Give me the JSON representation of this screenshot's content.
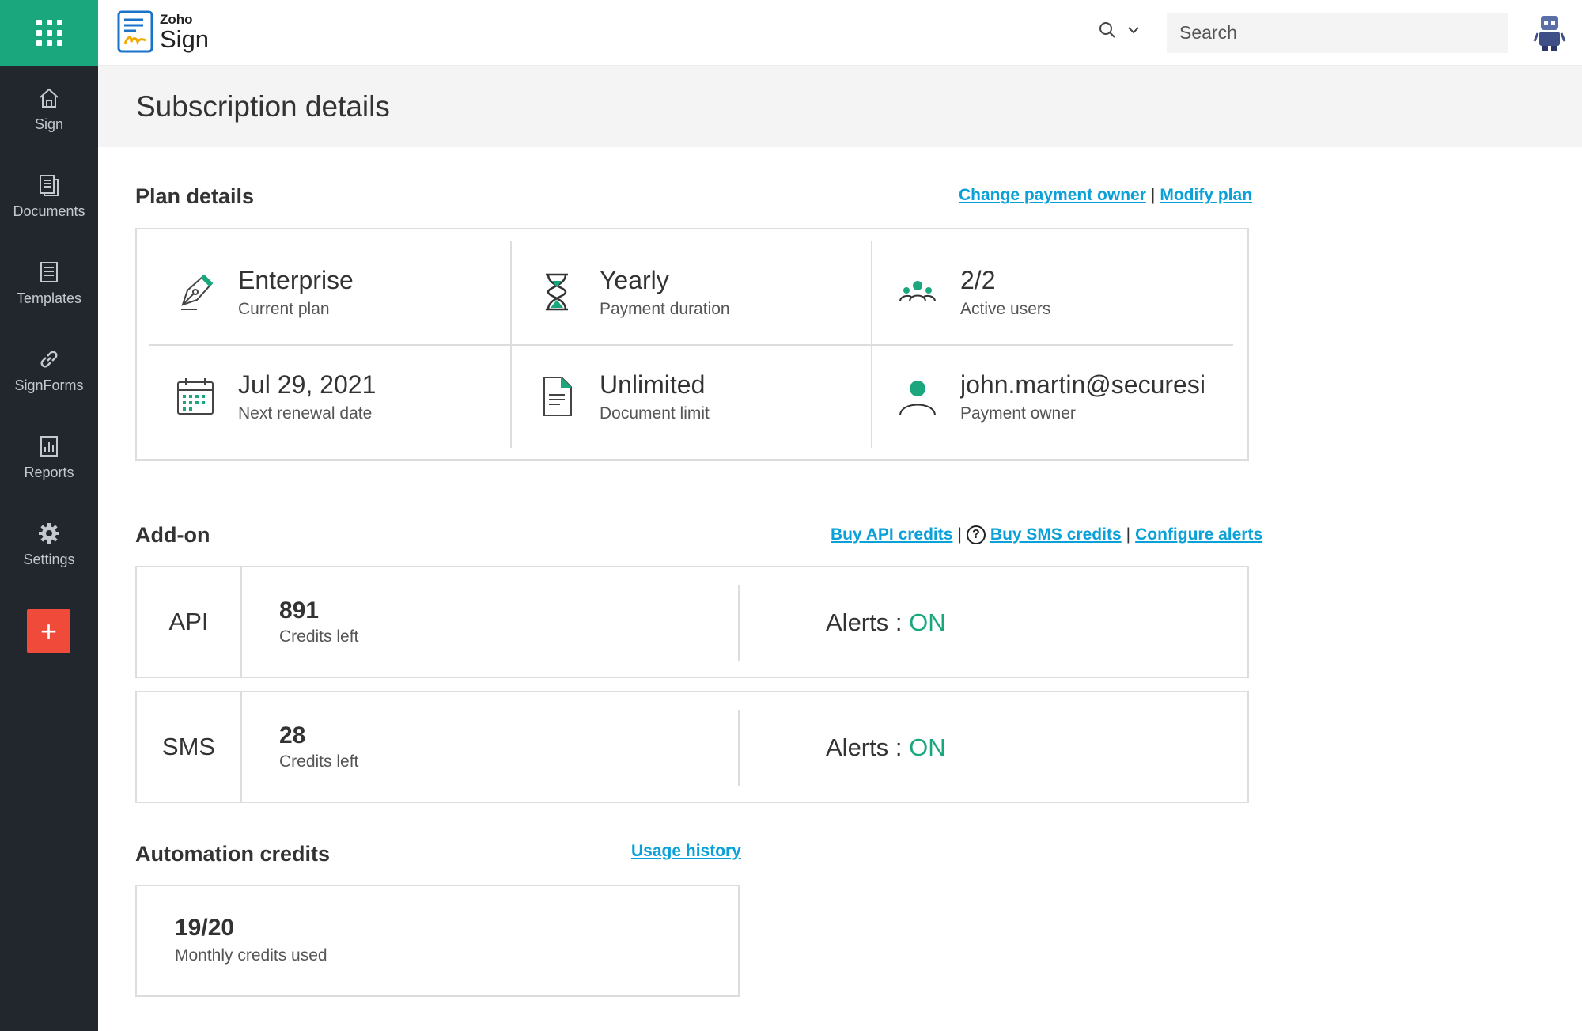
{
  "app": {
    "brand_small": "Zoho",
    "brand_name": "Sign"
  },
  "sidebar": {
    "items": [
      {
        "label": "Sign",
        "icon": "home-icon"
      },
      {
        "label": "Documents",
        "icon": "documents-icon"
      },
      {
        "label": "Templates",
        "icon": "templates-icon"
      },
      {
        "label": "SignForms",
        "icon": "link-icon"
      },
      {
        "label": "Reports",
        "icon": "reports-icon"
      },
      {
        "label": "Settings",
        "icon": "gear-icon"
      }
    ],
    "add_label": "+"
  },
  "header": {
    "search_placeholder": "Search"
  },
  "page": {
    "title": "Subscription details"
  },
  "plan": {
    "title": "Plan details",
    "links": {
      "change_owner": "Change payment owner",
      "separator": "|",
      "modify": "Modify plan"
    },
    "cells": [
      {
        "value": "Enterprise",
        "label": "Current plan",
        "icon": "pen-nib-icon"
      },
      {
        "value": "Yearly",
        "label": "Payment duration",
        "icon": "hourglass-icon"
      },
      {
        "value": "2/2",
        "label": "Active users",
        "icon": "users-icon"
      },
      {
        "value": "Jul 29, 2021",
        "label": "Next renewal date",
        "icon": "calendar-icon"
      },
      {
        "value": "Unlimited",
        "label": "Document limit",
        "icon": "document-icon"
      },
      {
        "value": "john.martin@securesig",
        "label": "Payment owner",
        "icon": "user-icon"
      }
    ]
  },
  "addon": {
    "title": "Add-on",
    "links": {
      "buy_api": "Buy API credits",
      "sep1": "|",
      "help": "?",
      "buy_sms": "Buy SMS credits",
      "sep2": "|",
      "configure": "Configure alerts"
    },
    "items": [
      {
        "name": "API",
        "credits": "891",
        "credits_label": "Credits left",
        "alerts_label": "Alerts :",
        "alerts_value": "ON"
      },
      {
        "name": "SMS",
        "credits": "28",
        "credits_label": "Credits left",
        "alerts_label": "Alerts :",
        "alerts_value": "ON"
      }
    ]
  },
  "automation": {
    "title": "Automation credits",
    "link": "Usage history",
    "value": "19/20",
    "label": "Monthly credits used"
  },
  "colors": {
    "accent": "#1aa77e",
    "link": "#0aa0d8",
    "add_button": "#ef4a3a",
    "sidebar": "#22272e"
  }
}
